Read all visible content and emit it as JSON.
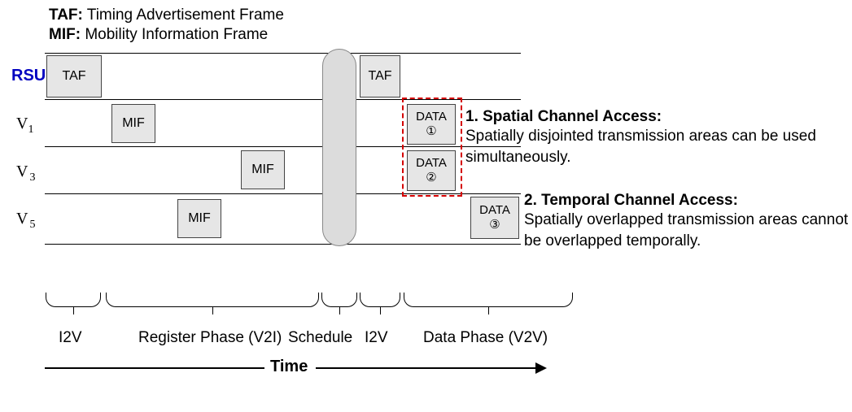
{
  "legend": {
    "taf_abbr": "TAF:",
    "taf_full": " Timing Advertisement Frame",
    "mif_abbr": "MIF:",
    "mif_full": " Mobility Information Frame"
  },
  "rows": {
    "rsu": "RSU",
    "v1": "V",
    "v1_sub": "1",
    "v3": "V",
    "v3_sub": "3",
    "v5": "V",
    "v5_sub": "5"
  },
  "boxes": {
    "taf1": "TAF",
    "taf2": "TAF",
    "mif1": "MIF",
    "mif3": "MIF",
    "mif5": "MIF",
    "data1_label": "DATA",
    "data1_num": "①",
    "data2_label": "DATA",
    "data2_num": "②",
    "data3_label": "DATA",
    "data3_num": "③"
  },
  "annotations": {
    "a1_title": "1. Spatial Channel Access:",
    "a1_body": "Spatially disjointed transmission areas can be used simultaneously.",
    "a2_title": "2. Temporal Channel Access:",
    "a2_body": "Spatially overlapped transmission areas cannot be overlapped temporally."
  },
  "phases": {
    "p1": "I2V",
    "p2": "Register Phase (V2I)",
    "p3": "Schedule",
    "p4": "I2V",
    "p5": "Data Phase (V2V)"
  },
  "axis": {
    "time": "Time"
  }
}
